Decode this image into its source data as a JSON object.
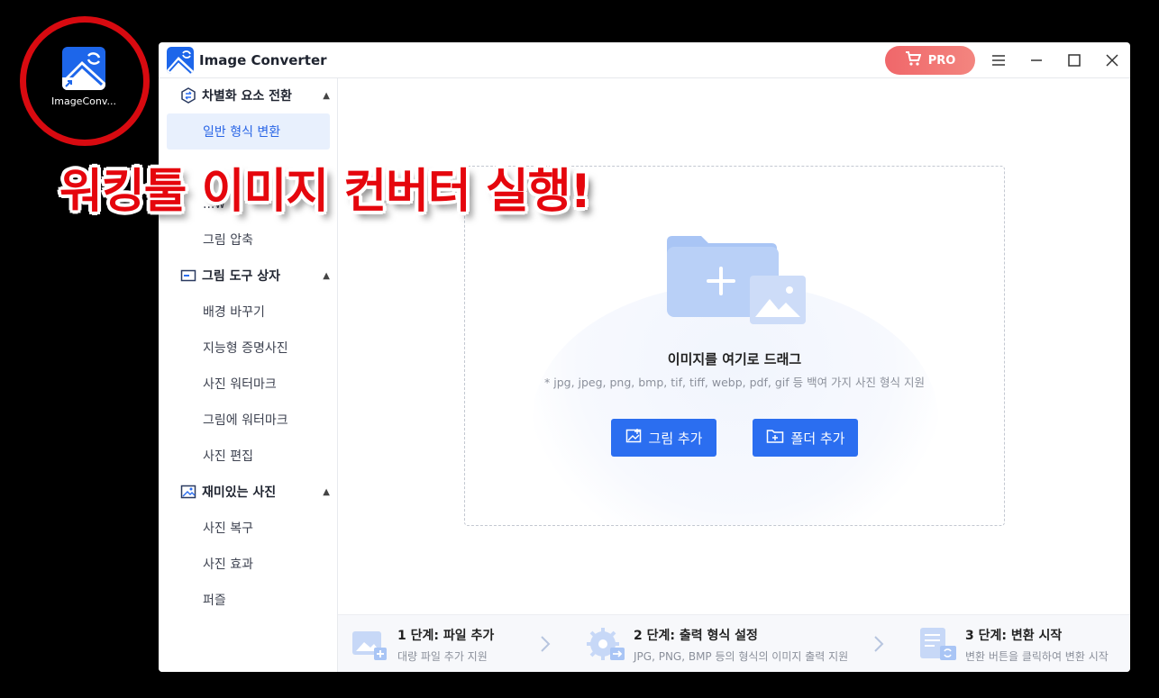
{
  "desktop": {
    "icon_label": "ImageConv..."
  },
  "window": {
    "title": "Image Converter",
    "pro_label": "PRO",
    "colors": {
      "accent": "#2b6ef0",
      "pro": "#f0676a",
      "active_bg": "#e8f0fd"
    }
  },
  "sidebar": {
    "sections": [
      {
        "label": "차별화 요소 전환",
        "icon": "convert-icon",
        "items": [
          "일반 형식 변환",
          "...w 변",
          "그림 압축"
        ]
      },
      {
        "label": "그림 도구 상자",
        "icon": "toolbox-icon",
        "items": [
          "배경 바꾸기",
          "지능형 증명사진",
          "사진 워터마크",
          "그림에 워터마크",
          "사진 편집"
        ]
      },
      {
        "label": "재미있는 사진",
        "icon": "fun-photo-icon",
        "items": [
          "사진 복구",
          "사진 효과",
          "퍼즐"
        ]
      }
    ],
    "active_item": "일반 형식 변환"
  },
  "dropzone": {
    "title": "이미지를 여기로 드래그",
    "subtitle": "* jpg, jpeg, png, bmp, tif, tiff, webp, pdf, gif 등 백여 가지 사진 형식 지원",
    "add_image": "그림 추가",
    "add_folder": "폴더 추가"
  },
  "steps": [
    {
      "title": "1 단계:  파일 추가",
      "desc": "대량 파일 추가 지원"
    },
    {
      "title": "2 단계:  출력 형식 설정",
      "desc": "JPG, PNG, BMP 등의 형식의 이미지 출력 지원"
    },
    {
      "title": "3 단계:  변환 시작",
      "desc": "변환 버튼을 클릭하여 변환 시작"
    }
  ],
  "overlay": {
    "caption": "워킹툴 이미지 컨버터 실행!"
  }
}
